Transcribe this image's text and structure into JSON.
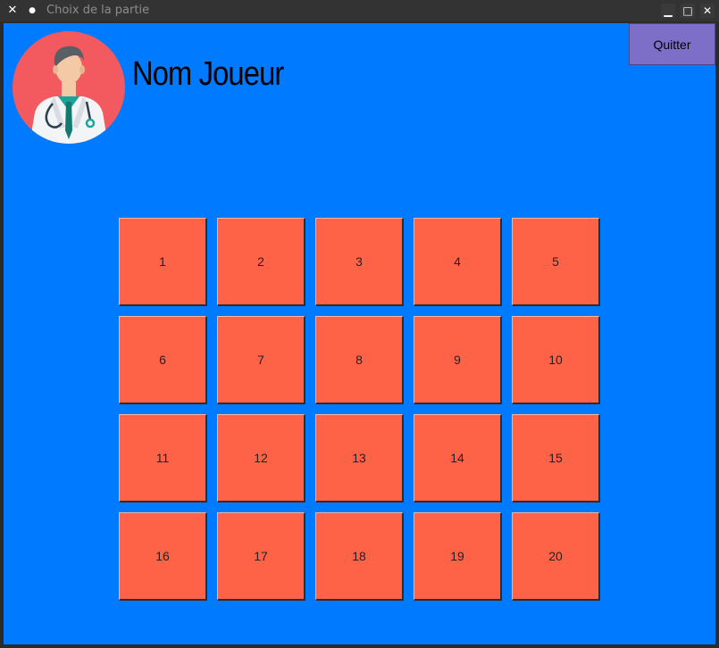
{
  "window": {
    "title": "Choix de la partie",
    "close_glyph": "✕",
    "menu_glyph": "●",
    "minimize_glyph": "▁",
    "maximize_glyph": "□",
    "close_ctrl_glyph": "✕"
  },
  "player": {
    "name": "Nom Joueur",
    "avatar_icon": "doctor-avatar-icon"
  },
  "actions": {
    "quit_label": "Quitter"
  },
  "levels": [
    "1",
    "2",
    "3",
    "4",
    "5",
    "6",
    "7",
    "8",
    "9",
    "10",
    "11",
    "12",
    "13",
    "14",
    "15",
    "16",
    "17",
    "18",
    "19",
    "20"
  ],
  "colors": {
    "background": "#007aff",
    "level_button": "#ff6347",
    "quit_button": "#7d6fc7",
    "titlebar": "#333333"
  }
}
